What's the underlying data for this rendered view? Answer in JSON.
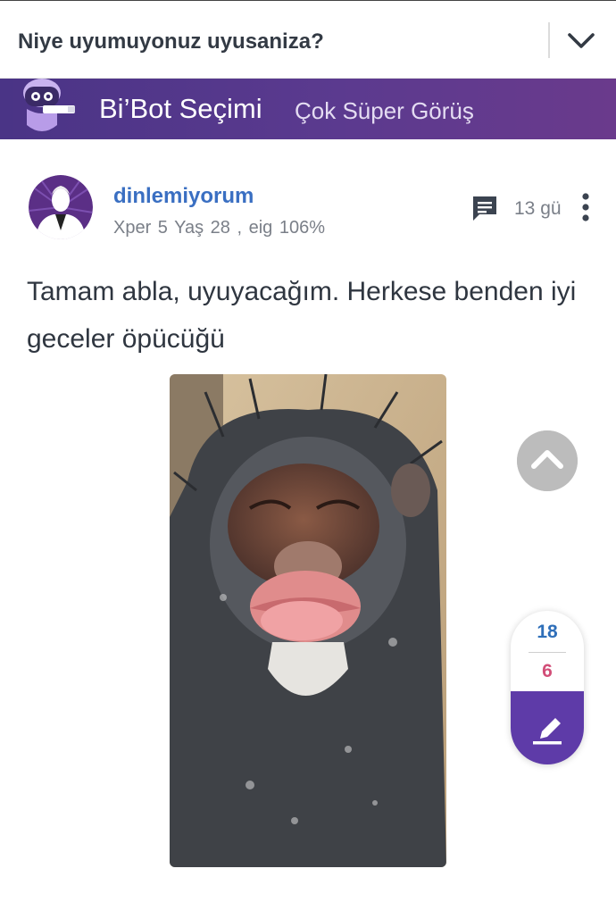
{
  "header": {
    "title": "Niye uyumuyonuz uyusaniza?",
    "collapse_icon": "chevron-down-icon"
  },
  "banner": {
    "name": "Bi’Bot Seçimi",
    "tagline": "Çok Süper Görüş",
    "gradient": [
      "#4a3486",
      "#6a3a8c"
    ]
  },
  "post": {
    "username": "dinlemiyorum",
    "meta": "Xper 5  Yaş 28 , eig 106%",
    "age": "13 gü",
    "text": "Tamam abla, uyuyacağım. Herkese benden iyi geceler öpücüğü",
    "image_icon": "chimp-kiss-photo"
  },
  "votes": {
    "up": "18",
    "down": "6",
    "edit_icon": "pencil-icon"
  },
  "colors": {
    "accent": "#5e3ba8",
    "username": "#3a6fc2",
    "downvote": "#d24e78"
  }
}
